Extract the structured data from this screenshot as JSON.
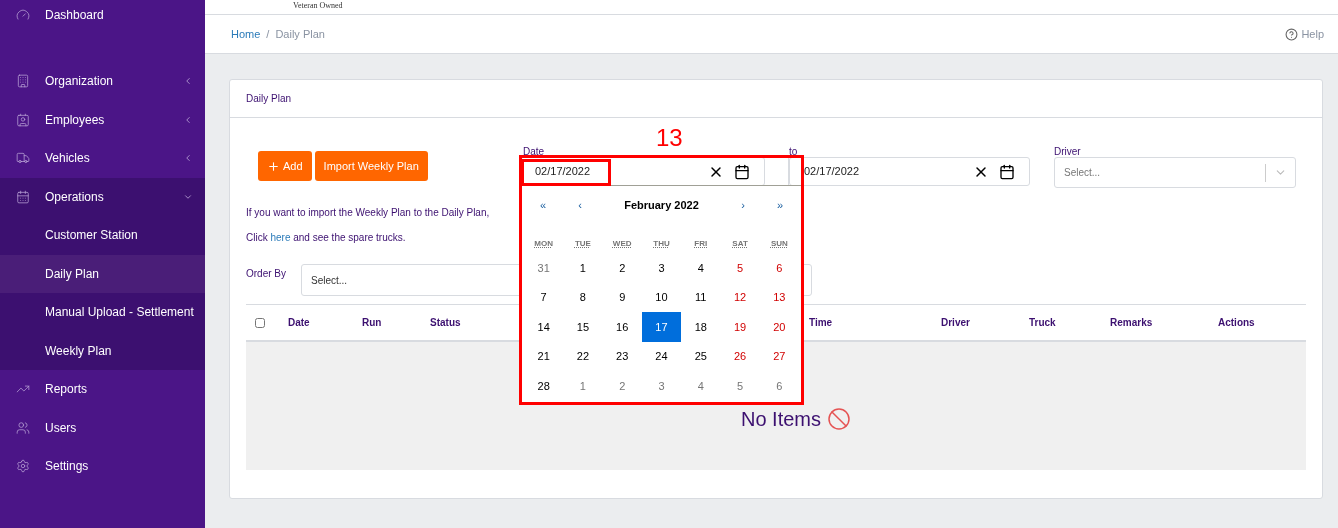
{
  "logo": {
    "tagline": "Veteran Owned"
  },
  "sidebar": {
    "items": [
      {
        "label": "Dashboard"
      },
      {
        "label": "Organization",
        "expanded": false
      },
      {
        "label": "Employees",
        "expanded": false
      },
      {
        "label": "Vehicles",
        "expanded": false
      },
      {
        "label": "Operations",
        "expanded": true,
        "children": [
          {
            "label": "Customer Station",
            "selected": false
          },
          {
            "label": "Daily Plan",
            "selected": true
          },
          {
            "label": "Manual Upload - Settlement",
            "selected": false
          },
          {
            "label": "Weekly Plan",
            "selected": false
          }
        ]
      },
      {
        "label": "Reports"
      },
      {
        "label": "Users"
      },
      {
        "label": "Settings"
      }
    ]
  },
  "breadcrumb": {
    "home": "Home",
    "separator": "/",
    "current": "Daily Plan",
    "help": "Help"
  },
  "card": {
    "title": "Daily Plan",
    "buttons": [
      {
        "kind": "add",
        "label": "Add"
      },
      {
        "kind": "plain",
        "label": "Import Weekly Plan"
      }
    ],
    "date_filter": {
      "label": "Date",
      "from_value": "02/17/2022",
      "to_label": "to",
      "to_value": "02/17/2022"
    },
    "driver_filter": {
      "label": "Driver",
      "placeholder": "Select..."
    },
    "info_text": "If you want to import the Weekly Plan to the Daily Plan,",
    "spare_text": {
      "before": "Click",
      "link": "here",
      "after": "and see the spare trucks."
    },
    "order_by": {
      "label": "Order By",
      "placeholder": "Select..."
    },
    "table": {
      "select_all_checked": false,
      "columns": [
        "Date",
        "Run",
        "Status",
        "Time",
        "Driver",
        "Truck",
        "Remarks",
        "Actions"
      ],
      "empty_text": "No Items"
    }
  },
  "calendar": {
    "prev_year": "«",
    "prev_month": "‹",
    "title": "February 2022",
    "next_month": "›",
    "next_year": "»",
    "weekdays": [
      "MON",
      "TUE",
      "WED",
      "THU",
      "FRI",
      "SAT",
      "SUN"
    ],
    "weeks": [
      [
        {
          "day": "31",
          "kind": "other"
        },
        {
          "day": "1",
          "kind": "weekday"
        },
        {
          "day": "2",
          "kind": "weekday"
        },
        {
          "day": "3",
          "kind": "weekday"
        },
        {
          "day": "4",
          "kind": "weekday"
        },
        {
          "day": "5",
          "kind": "weekend"
        },
        {
          "day": "6",
          "kind": "weekend"
        }
      ],
      [
        {
          "day": "7",
          "kind": "weekday"
        },
        {
          "day": "8",
          "kind": "weekday"
        },
        {
          "day": "9",
          "kind": "weekday"
        },
        {
          "day": "10",
          "kind": "weekday"
        },
        {
          "day": "11",
          "kind": "weekday"
        },
        {
          "day": "12",
          "kind": "weekend"
        },
        {
          "day": "13",
          "kind": "weekend"
        }
      ],
      [
        {
          "day": "14",
          "kind": "weekday"
        },
        {
          "day": "15",
          "kind": "weekday"
        },
        {
          "day": "16",
          "kind": "weekday"
        },
        {
          "day": "17",
          "kind": "weekday",
          "selected": true
        },
        {
          "day": "18",
          "kind": "weekday"
        },
        {
          "day": "19",
          "kind": "weekend"
        },
        {
          "day": "20",
          "kind": "weekend"
        }
      ],
      [
        {
          "day": "21",
          "kind": "weekday"
        },
        {
          "day": "22",
          "kind": "weekday"
        },
        {
          "day": "23",
          "kind": "weekday"
        },
        {
          "day": "24",
          "kind": "weekday"
        },
        {
          "day": "25",
          "kind": "weekday"
        },
        {
          "day": "26",
          "kind": "weekend"
        },
        {
          "day": "27",
          "kind": "weekend"
        }
      ],
      [
        {
          "day": "28",
          "kind": "weekday"
        },
        {
          "day": "1",
          "kind": "other"
        },
        {
          "day": "2",
          "kind": "other"
        },
        {
          "day": "3",
          "kind": "other"
        },
        {
          "day": "4",
          "kind": "other"
        },
        {
          "day": "5",
          "kind": "other"
        },
        {
          "day": "6",
          "kind": "other"
        }
      ]
    ]
  },
  "annotation": {
    "label": "13"
  }
}
